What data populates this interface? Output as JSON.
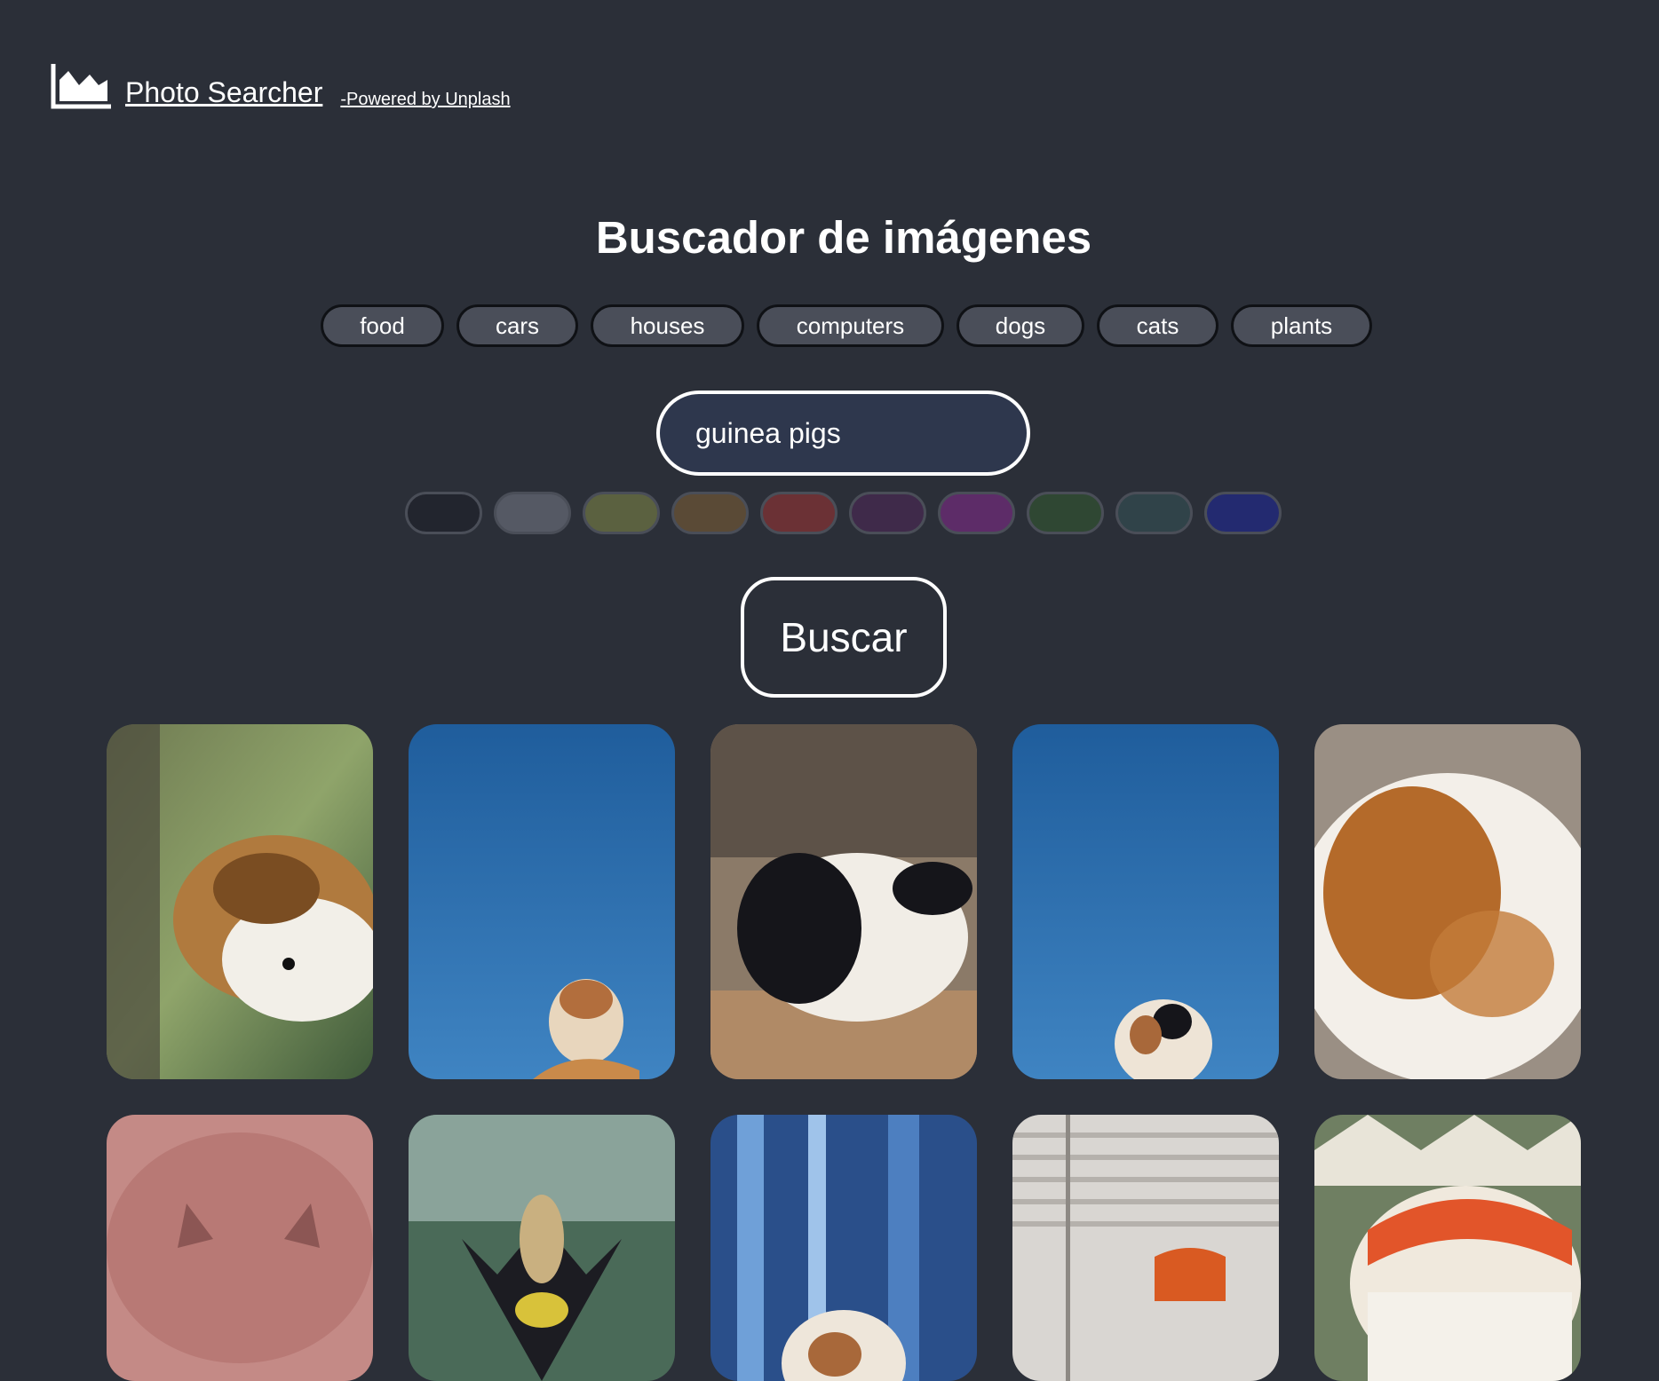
{
  "header": {
    "icon": "mountain-chart-icon",
    "title": "Photo Searcher",
    "powered_by": "-Powered by Unplash"
  },
  "main": {
    "heading": "Buscador de imágenes",
    "categories": [
      "food",
      "cars",
      "houses",
      "computers",
      "dogs",
      "cats",
      "plants"
    ],
    "search": {
      "value": "guinea pigs"
    },
    "color_filters": [
      "#22252e",
      "#555964",
      "#5b6140",
      "#5a4a36",
      "#6b3135",
      "#3f2a4a",
      "#5d2c68",
      "#2f4733",
      "#304349",
      "#232a70"
    ],
    "search_button": "Buscar"
  },
  "results": {
    "subjects": [
      "guinea pig in forest",
      "guinea pig against blue sky",
      "black and white guinea pig",
      "guinea pig against blue sky",
      "fluffy brown guinea pig",
      "pink pig close-up",
      "feathered costume",
      "guinea pig with blue background",
      "room with orange chair",
      "feather headdress"
    ]
  }
}
